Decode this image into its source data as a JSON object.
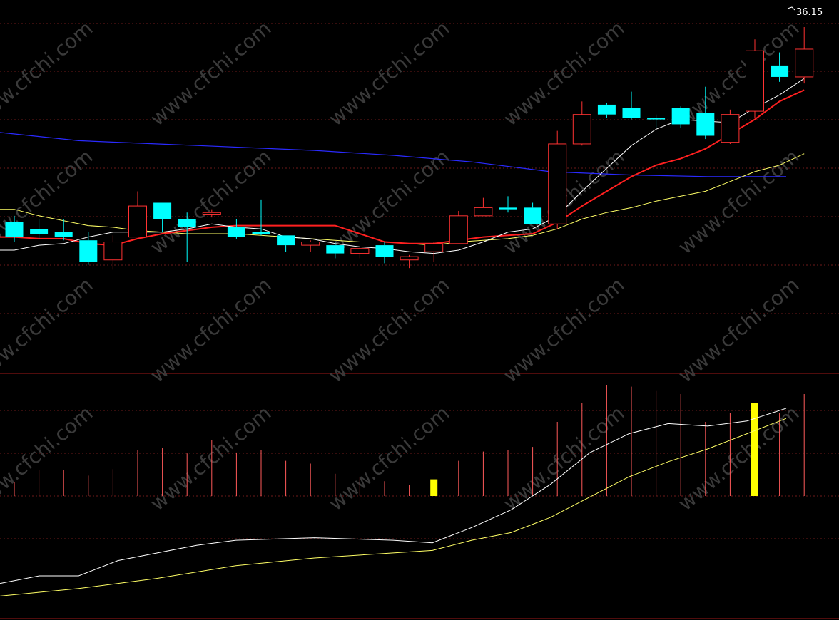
{
  "chart_data": {
    "type": "candlestick",
    "high_label": "36.15",
    "watermark": "www.cfchi.com",
    "colors": {
      "up": "#ff3232",
      "down": "#00ffff",
      "ma5": "#ffffff",
      "ma10": "#ff2020",
      "ma30": "#ffff66",
      "ma_long": "#2a2aff",
      "vol_up": "#ff5a5a",
      "vol_highlight": "#ffff00",
      "divider": "#a01818",
      "grid": "#6e1a1a"
    },
    "price_axis": {
      "min": 16.0,
      "max": 36.5
    },
    "candles": [
      {
        "o": 24.2,
        "h": 24.6,
        "l": 23.0,
        "c": 23.3
      },
      {
        "o": 23.8,
        "h": 24.4,
        "l": 23.2,
        "c": 23.5
      },
      {
        "o": 23.6,
        "h": 24.4,
        "l": 23.1,
        "c": 23.3
      },
      {
        "o": 23.1,
        "h": 23.6,
        "l": 21.6,
        "c": 21.8
      },
      {
        "o": 21.9,
        "h": 23.4,
        "l": 21.3,
        "c": 23.0
      },
      {
        "o": 23.3,
        "h": 26.1,
        "l": 23.3,
        "c": 25.2
      },
      {
        "o": 25.4,
        "h": 25.4,
        "l": 23.6,
        "c": 24.4
      },
      {
        "o": 24.4,
        "h": 24.8,
        "l": 21.8,
        "c": 23.9
      },
      {
        "o": 24.7,
        "h": 25.0,
        "l": 24.5,
        "c": 24.8
      },
      {
        "o": 23.9,
        "h": 24.4,
        "l": 23.2,
        "c": 23.3
      },
      {
        "o": 23.6,
        "h": 25.6,
        "l": 23.4,
        "c": 23.5
      },
      {
        "o": 23.4,
        "h": 23.4,
        "l": 22.4,
        "c": 22.8
      },
      {
        "o": 22.8,
        "h": 23.1,
        "l": 22.4,
        "c": 23.0
      },
      {
        "o": 22.8,
        "h": 23.0,
        "l": 22.0,
        "c": 22.3
      },
      {
        "o": 22.3,
        "h": 22.7,
        "l": 22.0,
        "c": 22.6
      },
      {
        "o": 22.8,
        "h": 23.0,
        "l": 21.7,
        "c": 22.1
      },
      {
        "o": 21.9,
        "h": 22.2,
        "l": 21.4,
        "c": 22.1
      },
      {
        "o": 22.4,
        "h": 23.0,
        "l": 21.8,
        "c": 22.9
      },
      {
        "o": 22.9,
        "h": 24.9,
        "l": 22.9,
        "c": 24.6
      },
      {
        "o": 24.6,
        "h": 25.7,
        "l": 24.6,
        "c": 25.1
      },
      {
        "o": 25.1,
        "h": 25.8,
        "l": 24.8,
        "c": 25.0
      },
      {
        "o": 25.1,
        "h": 25.4,
        "l": 24.2,
        "c": 24.1
      },
      {
        "o": 24.1,
        "h": 29.8,
        "l": 23.8,
        "c": 29.0
      },
      {
        "o": 29.0,
        "h": 31.6,
        "l": 28.9,
        "c": 30.8
      },
      {
        "o": 31.4,
        "h": 31.5,
        "l": 30.6,
        "c": 30.8
      },
      {
        "o": 31.2,
        "h": 32.2,
        "l": 30.5,
        "c": 30.6
      },
      {
        "o": 30.6,
        "h": 30.8,
        "l": 30.0,
        "c": 30.5
      },
      {
        "o": 31.2,
        "h": 31.3,
        "l": 30.0,
        "c": 30.2
      },
      {
        "o": 30.9,
        "h": 32.5,
        "l": 29.3,
        "c": 29.5
      },
      {
        "o": 29.1,
        "h": 31.1,
        "l": 29.0,
        "c": 30.8
      },
      {
        "o": 31.0,
        "h": 35.4,
        "l": 30.6,
        "c": 34.7
      },
      {
        "o": 33.8,
        "h": 34.6,
        "l": 32.8,
        "c": 33.1
      },
      {
        "o": 33.1,
        "h": 36.15,
        "l": 32.7,
        "c": 34.8
      }
    ],
    "ma5": [
      22.5,
      22.8,
      22.9,
      23.3,
      23.6,
      23.6,
      23.6,
      23.8,
      24.1,
      23.9,
      23.8,
      23.3,
      23.2,
      22.9,
      22.7,
      22.6,
      22.4,
      22.3,
      22.5,
      23.0,
      23.6,
      23.8,
      24.6,
      26.1,
      27.5,
      28.9,
      29.9,
      30.5,
      30.4,
      30.3,
      31.2,
      32.0,
      33.0
    ],
    "ma10": [
      23.3,
      23.2,
      23.2,
      22.9,
      22.8,
      23.2,
      23.5,
      23.7,
      23.9,
      24.0,
      24.0,
      24.0,
      24.0,
      24.0,
      23.5,
      23.0,
      22.9,
      22.9,
      23.1,
      23.3,
      23.4,
      23.5,
      24.2,
      25.2,
      26.1,
      27.0,
      27.7,
      28.1,
      28.7,
      29.6,
      30.5,
      31.6,
      32.3
    ],
    "ma30": [
      25.0,
      24.6,
      24.3,
      24.0,
      23.9,
      23.7,
      23.6,
      23.5,
      23.5,
      23.5,
      23.4,
      23.3,
      23.2,
      23.1,
      23.0,
      23.0,
      22.9,
      22.8,
      23.0,
      23.1,
      23.2,
      23.4,
      23.8,
      24.4,
      24.8,
      25.1,
      25.5,
      25.8,
      26.1,
      26.7,
      27.3,
      27.7,
      28.4
    ],
    "ma_long": [
      [
        0,
        29.7
      ],
      [
        0.1,
        29.2
      ],
      [
        0.25,
        28.9
      ],
      [
        0.4,
        28.6
      ],
      [
        0.5,
        28.3
      ],
      [
        0.6,
        27.9
      ],
      [
        0.7,
        27.3
      ],
      [
        0.8,
        27.1
      ],
      [
        0.9,
        27.0
      ],
      [
        1.0,
        27.0
      ]
    ],
    "volume_axis": {
      "min": 0,
      "max": 100
    },
    "volumes": [
      15,
      28,
      28,
      22,
      29,
      50,
      52,
      46,
      60,
      47,
      50,
      38,
      35,
      24,
      20,
      16,
      12,
      18,
      38,
      48,
      50,
      53,
      80,
      100,
      120,
      118,
      114,
      110,
      80,
      90,
      100,
      90,
      110
    ],
    "volume_highlight": [
      17,
      30
    ],
    "volume_ma_white": [
      [
        0,
        12
      ],
      [
        0.05,
        18
      ],
      [
        0.1,
        18
      ],
      [
        0.15,
        30
      ],
      [
        0.2,
        36
      ],
      [
        0.25,
        42
      ],
      [
        0.3,
        46
      ],
      [
        0.4,
        48
      ],
      [
        0.5,
        46
      ],
      [
        0.55,
        44
      ],
      [
        0.6,
        56
      ],
      [
        0.65,
        70
      ],
      [
        0.7,
        90
      ],
      [
        0.75,
        115
      ],
      [
        0.8,
        130
      ],
      [
        0.85,
        138
      ],
      [
        0.9,
        136
      ],
      [
        0.95,
        140
      ],
      [
        1.0,
        150
      ]
    ],
    "volume_ma_yellow": [
      [
        0,
        2
      ],
      [
        0.1,
        8
      ],
      [
        0.2,
        16
      ],
      [
        0.3,
        26
      ],
      [
        0.4,
        32
      ],
      [
        0.5,
        36
      ],
      [
        0.55,
        38
      ],
      [
        0.6,
        46
      ],
      [
        0.65,
        52
      ],
      [
        0.7,
        64
      ],
      [
        0.75,
        80
      ],
      [
        0.8,
        96
      ],
      [
        0.85,
        108
      ],
      [
        0.9,
        118
      ],
      [
        0.95,
        130
      ],
      [
        1.0,
        142
      ]
    ]
  }
}
